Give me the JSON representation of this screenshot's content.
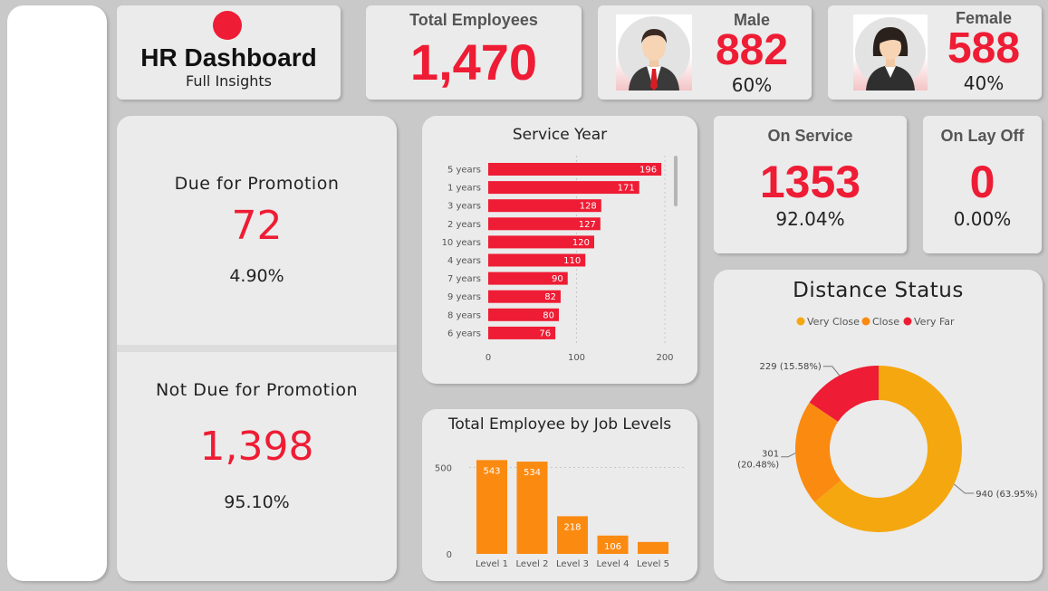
{
  "title_card": {
    "title": "HR Dashboard",
    "subtitle": "Full Insights"
  },
  "kpi_total": {
    "label": "Total Employees",
    "value": "1,470"
  },
  "kpi_male": {
    "label": "Male",
    "value": "882",
    "pct": "60%",
    "avatar_icon": "male-avatar-icon"
  },
  "kpi_female": {
    "label": "Female",
    "value": "588",
    "pct": "40%",
    "avatar_icon": "female-avatar-icon"
  },
  "promotion": {
    "due_label": "Due for Promotion",
    "due_value": "72",
    "due_pct": "4.90%",
    "not_due_label": "Not Due for Promotion",
    "not_due_value": "1,398",
    "not_due_pct": "95.10%"
  },
  "on_service": {
    "label": "On Service",
    "value": "1353",
    "pct": "92.04%"
  },
  "on_layoff": {
    "label": "On Lay Off",
    "value": "0",
    "pct": "0.00%"
  },
  "colors": {
    "accent_red": "#ee1c34",
    "orange": "#fb8a11",
    "gold": "#f5a70f",
    "card_bg": "#ebebeb",
    "page_bg": "#c9c9c9"
  },
  "chart_data": [
    {
      "type": "bar",
      "orientation": "horizontal",
      "title": "Service Year",
      "categories": [
        "5 years",
        "1 years",
        "3 years",
        "2 years",
        "10 years",
        "4 years",
        "7 years",
        "9 years",
        "8 years",
        "6 years"
      ],
      "values": [
        196,
        171,
        128,
        127,
        120,
        110,
        90,
        82,
        80,
        76
      ],
      "data_labels": [
        "196",
        "171",
        "128",
        "127",
        "120",
        "110",
        "90",
        "82",
        "80",
        "76"
      ],
      "x_ticks": [
        "0",
        "100",
        "200"
      ],
      "xlim": [
        0,
        200
      ],
      "color": "#ee1c34"
    },
    {
      "type": "bar",
      "title": "Total Employee by Job Levels",
      "categories": [
        "Level 1",
        "Level 2",
        "Level 3",
        "Level 4",
        "Level 5"
      ],
      "values": [
        543,
        534,
        218,
        106,
        69
      ],
      "data_labels": [
        "543",
        "534",
        "218",
        "106",
        ""
      ],
      "y_ticks": [
        "500",
        "0"
      ],
      "ylim": [
        0,
        550
      ],
      "color": "#fb8a11"
    },
    {
      "type": "pie",
      "title": "Distance Status",
      "legend": [
        "Very Close",
        "Close",
        "Very Far"
      ],
      "legend_position": "top",
      "values": [
        940,
        301,
        229
      ],
      "colors": [
        "#f5a70f",
        "#fb8a11",
        "#ee1c34"
      ],
      "slice_labels": [
        "940 (63.95%)",
        "301",
        "(20.48%)",
        "229 (15.58%)"
      ]
    }
  ]
}
